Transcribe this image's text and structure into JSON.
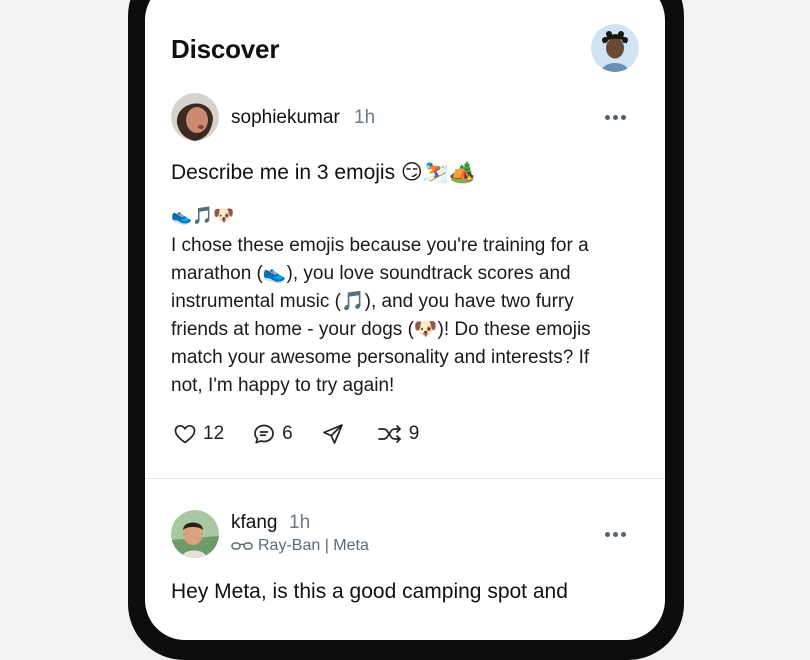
{
  "page": {
    "title": "Discover"
  },
  "colors": {
    "muted": "#6b7a8a",
    "icon": "#222222"
  },
  "post1": {
    "username": "sophiekumar",
    "time": "1h",
    "question": "Describe me in 3 emojis 😏⛷️🏕️",
    "emoji_line": "👟🎵🐶",
    "body": "I chose these emojis because you're training for a marathon (👟), you love soundtrack scores and instrumental music (🎵), and you have two furry friends at home - your dogs (🐶)! Do these emojis match your awesome personality and interests? If not, I'm happy to try again!",
    "likes": "12",
    "comments": "6",
    "shares": "9"
  },
  "post2": {
    "username": "kfang",
    "time": "1h",
    "device": "Ray-Ban | Meta",
    "text": "Hey Meta, is this a good camping spot and"
  },
  "icons": [
    "heart-icon",
    "comment-icon",
    "send-icon",
    "shuffle-icon",
    "more-icon",
    "glasses-icon"
  ]
}
